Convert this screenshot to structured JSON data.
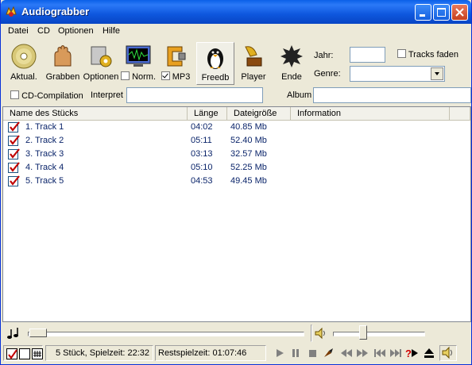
{
  "window": {
    "title": "Audiograbber"
  },
  "menu": [
    {
      "label": "Datei"
    },
    {
      "label": "CD"
    },
    {
      "label": "Optionen"
    },
    {
      "label": "Hilfe"
    }
  ],
  "toolbar": {
    "aktual": "Aktual.",
    "grabben": "Grabben",
    "optionen": "Optionen",
    "norm": "Norm.",
    "mp3": "MP3",
    "freedb": "Freedb",
    "player": "Player",
    "ende": "Ende",
    "jahr_label": "Jahr:",
    "jahr_value": "",
    "tracks_faden": "Tracks faden",
    "genre_label": "Genre:",
    "genre_value": "",
    "norm_checked": false,
    "mp3_checked": true,
    "tracks_faden_checked": false
  },
  "cdinfo": {
    "compilation_label": "CD-Compilation",
    "compilation_checked": false,
    "interpret_label": "Interpret",
    "interpret_value": "",
    "album_label": "Album",
    "album_value": ""
  },
  "table": {
    "columns": [
      "Name des Stücks",
      "Länge",
      "Dateigröße",
      "Information"
    ],
    "rows": [
      {
        "name": "1. Track  1",
        "length": "04:02",
        "size": "40.85 Mb",
        "info": "",
        "checked": true
      },
      {
        "name": "2. Track  2",
        "length": "05:11",
        "size": "52.40 Mb",
        "info": "",
        "checked": true
      },
      {
        "name": "3. Track  3",
        "length": "03:13",
        "size": "32.57 Mb",
        "info": "",
        "checked": true
      },
      {
        "name": "4. Track  4",
        "length": "05:10",
        "size": "52.25 Mb",
        "info": "",
        "checked": true
      },
      {
        "name": "5. Track  5",
        "length": "04:53",
        "size": "49.45 Mb",
        "info": "",
        "checked": true
      }
    ]
  },
  "status": {
    "count": "5 Stück,  Spielzeit: 22:32",
    "remaining": "Restspielzeit: 01:07:46",
    "position_fraction": 0.0,
    "volume_fraction": 0.3
  },
  "colors": {
    "titlebar": "#0a5fe8",
    "list_text": "#0a246a",
    "check_red": "#c00000"
  }
}
